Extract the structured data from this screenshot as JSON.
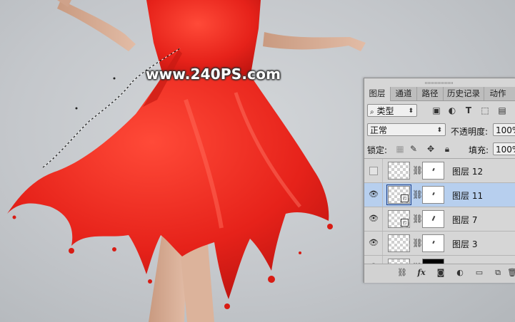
{
  "watermark": "www.240PS.com",
  "panel": {
    "tabs": [
      {
        "label": "图层",
        "active": true
      },
      {
        "label": "通道",
        "active": false
      },
      {
        "label": "路径",
        "active": false
      },
      {
        "label": "历史记录",
        "active": false
      },
      {
        "label": "动作",
        "active": false
      }
    ],
    "filter": {
      "icon": "search-icon",
      "value": "类型"
    },
    "blend_mode": "正常",
    "opacity_label": "不透明度:",
    "opacity_value": "100%",
    "lock_label": "锁定:",
    "fill_label": "填充:",
    "fill_value": "100%",
    "layers": [
      {
        "name": "图层 12",
        "visible": false,
        "selected": false,
        "smart": false,
        "mask": "white"
      },
      {
        "name": "图层 11",
        "visible": true,
        "selected": true,
        "smart": true,
        "mask": "white"
      },
      {
        "name": "图层 7",
        "visible": true,
        "selected": false,
        "smart": true,
        "mask": "white"
      },
      {
        "name": "图层 3",
        "visible": true,
        "selected": false,
        "smart": false,
        "mask": "white"
      },
      {
        "name": "图层",
        "visible": true,
        "selected": false,
        "smart": false,
        "mask": "black"
      }
    ]
  },
  "colors": {
    "dress": "#e8231b",
    "selection": "#b7cfee",
    "background": "#c7cace"
  }
}
